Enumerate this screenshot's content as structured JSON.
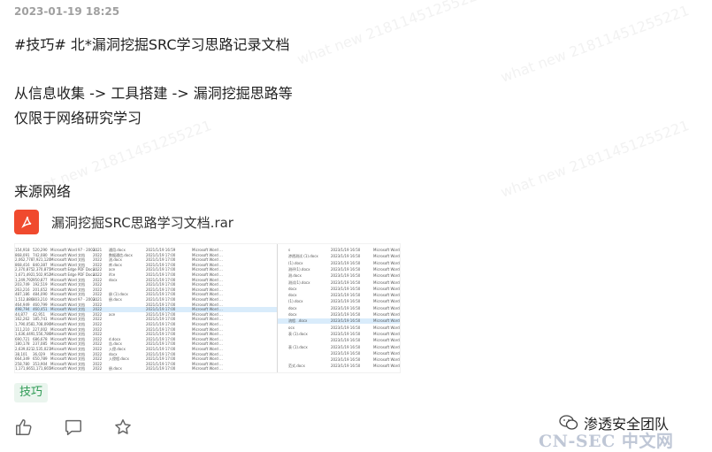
{
  "post": {
    "timestamp": "2023-01-19 18:25",
    "lines": [
      "#技巧# 北*漏洞挖掘SRC学习思路记录文档",
      "从信息收集 -> 工具搭建 -> 漏洞挖掘思路等",
      "仅限于网络研究学习",
      "来源网络"
    ],
    "attachment": {
      "name": "漏洞挖掘SRC思路学习文档.rar",
      "icon": "pdf-file-icon"
    },
    "tag": "技巧"
  },
  "brand": {
    "name": "渗透安全团队",
    "icon": "wechat-icon"
  },
  "watermark": "CN-SEC 中文网",
  "faint_watermark": "what new 21811451255221",
  "actions": [
    "like-icon",
    "comment-icon",
    "favorite-icon"
  ],
  "file_list_left": [
    [
      "154,918",
      "520,290",
      "Microsoft Word 97 - 2003...",
      "2021",
      "通用.docx",
      "2021/1/19 16:59",
      "Microsoft Word ..."
    ],
    [
      "868,091",
      "742,080",
      "Microsoft Word 文档",
      "2022",
      "数据通信.docx",
      "2021/1/19 17:00",
      "Microsoft Word ..."
    ],
    [
      "2,062,778",
      "7,921,120",
      "Microsoft Word 文档",
      "2022",
      "流.docx",
      "2021/1/19 17:00",
      "Microsoft Word ..."
    ],
    [
      "868,416",
      "840,387",
      "Microsoft Word 文档",
      "2022",
      "库.docx",
      "2021/1/19 17:00",
      "Microsoft Word ..."
    ],
    [
      "2,370,875",
      "2,370,875",
      "Microsoft Edge PDF Docu...",
      "2022",
      "ace",
      "2021/1/19 17:00",
      "Microsoft Word ..."
    ],
    [
      "1,671,492",
      "1,502,952",
      "Microsoft Edge PDF Docu...",
      "2022",
      "ifce",
      "2021/1/19 17:00",
      "Microsoft Word ..."
    ],
    [
      "1,249,792",
      "950,877",
      "Microsoft Word 文档",
      "2022",
      "docx",
      "2021/1/19 17:00",
      "Microsoft Word ..."
    ],
    [
      "203,749",
      "192,519",
      "Microsoft Word 文档",
      "2022",
      "",
      "2021/1/19 17:00",
      "Microsoft Word ..."
    ],
    [
      "263,216",
      "201,652",
      "Microsoft Word 文档",
      "2022",
      "",
      "2021/1/19 17:00",
      "Microsoft Word ..."
    ],
    [
      "487,186",
      "484,090",
      "Microsoft Word 文档",
      "2022",
      "册 (1).docx",
      "2021/1/19 17:00",
      "Microsoft Word ..."
    ],
    [
      "1,512,886",
      "803,210",
      "Microsoft Word 97 - 2003...",
      "2021",
      "册.docx",
      "2021/1/19 17:00",
      "Microsoft Word ..."
    ],
    [
      "464,949",
      "460,799",
      "Microsoft Word 文档",
      "2022",
      "",
      "2021/1/19 17:00",
      "Microsoft Word ..."
    ],
    [
      "498,794",
      "460,451",
      "Microsoft Word 文档",
      "2022",
      "",
      "2021/1/19 17:00",
      "Microsoft Word ..."
    ],
    [
      "44,877",
      "42,951",
      "Microsoft Word 文档",
      "2022",
      "ace",
      "2021/1/19 17:00",
      "Microsoft Word ..."
    ],
    [
      "162,262",
      "185,741",
      "Microsoft Word 文档",
      "2022",
      "",
      "2021/1/19 17:00",
      "Microsoft Word ..."
    ],
    [
      "1,790,058",
      "1,708,090",
      "Microsoft Word 文档",
      "2022",
      "",
      "2021/1/19 17:00",
      "Microsoft Word ..."
    ],
    [
      "111,210",
      "227,002",
      "Microsoft Word 文档",
      "2022",
      "",
      "2021/1/19 17:00",
      "Microsoft Word ..."
    ],
    [
      "1,636,449",
      "1,556,786",
      "Microsoft Word 文档",
      "2022",
      "",
      "2021/1/19 17:00",
      "Microsoft Word ..."
    ],
    [
      "690,721",
      "686,678",
      "Microsoft Word 文档",
      "2022",
      "d.docx",
      "2021/1/19 17:00",
      "Microsoft Word ..."
    ],
    [
      "180,178",
      "237,085",
      "Microsoft Word 文档",
      "2022",
      "告.docx",
      "2021/1/19 17:00",
      "Microsoft Word ..."
    ],
    [
      "2,639,021",
      "2,535,021",
      "Microsoft Word 文档",
      "2022",
      "入侵.docx",
      "2021/1/19 17:00",
      "Microsoft Word ..."
    ],
    [
      "38,101",
      "36,029",
      "Microsoft Word 文档",
      "2022",
      "docx",
      "2021/1/19 17:00",
      "Microsoft Word ..."
    ],
    [
      "664,349",
      "650,789",
      "Microsoft Word 文档",
      "2022",
      "入侵程.docx",
      "2021/1/19 17:00",
      "Microsoft Word ..."
    ],
    [
      "258,780",
      "353,904",
      "Microsoft Word 文档",
      "2022",
      "",
      "2021/1/19 17:00",
      "Microsoft Word ..."
    ],
    [
      "1,171,665",
      "1,171,665",
      "Microsoft Word 文档",
      "2022",
      "册.docx",
      "2021/1/19 17:00",
      "Microsoft Word ..."
    ]
  ],
  "file_list_right": [
    [
      "s",
      "2023/1/19 16:50",
      "Microsoft Word ..."
    ],
    [
      "渗透测试 (1).docx",
      "2023/1/19 16:50",
      "Microsoft Word ..."
    ],
    [
      "(1).docx",
      "2023/1/19 16:50",
      "Microsoft Word ..."
    ],
    [
      "测评(1).docx",
      "2023/1/19 16:50",
      "Microsoft Word ..."
    ],
    [
      "测.docx",
      "2023/1/19 16:50",
      "Microsoft Word ..."
    ],
    [
      "测试(1).docx",
      "2023/1/19 16:50",
      "Microsoft Word ..."
    ],
    [
      "docx",
      "2023/1/19 16:50",
      "Microsoft Word ..."
    ],
    [
      "docx",
      "2023/1/19 16:50",
      "Microsoft Word ..."
    ],
    [
      "(1).docx",
      "2023/1/19 16:50",
      "Microsoft Word ..."
    ],
    [
      "docx",
      "2023/1/19 16:50",
      "Microsoft Word ..."
    ],
    [
      "docx",
      "2023/1/19 16:50",
      "Microsoft Word ..."
    ],
    [
      "流程. .docx",
      "2023/1/19 16:50",
      "Microsoft Word ..."
    ],
    [
      "ocx",
      "2023/1/19 16:50",
      "Microsoft Word ..."
    ],
    [
      "表 (1).docx",
      "2023/1/19 16:50",
      "Microsoft Word ..."
    ],
    [
      "",
      "2023/1/19 16:50",
      "Microsoft Word ..."
    ],
    [
      "表 (1).docx",
      "2023/1/19 16:50",
      "Microsoft Word ..."
    ],
    [
      "",
      "2023/1/19 16:50",
      "Microsoft Word ..."
    ],
    [
      "",
      "2023/1/19 16:50",
      "Microsoft Word ..."
    ],
    [
      "范式.docx",
      "2023/1/19 16:50",
      "Microsoft Word ..."
    ]
  ]
}
